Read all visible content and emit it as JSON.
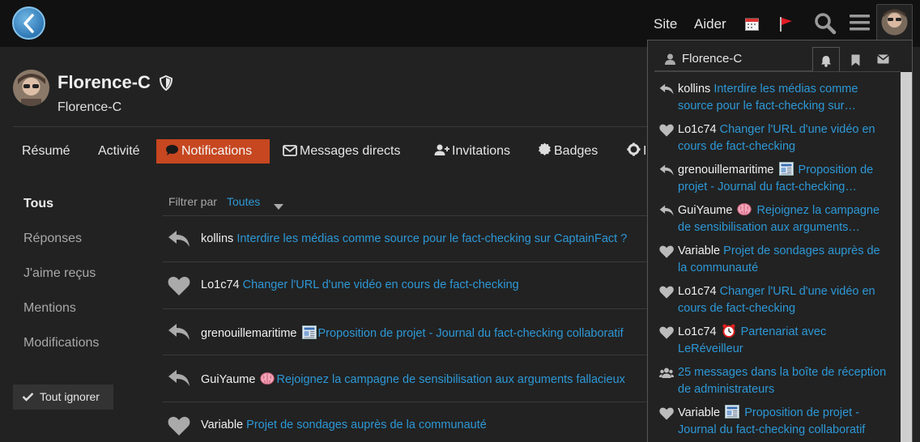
{
  "header": {
    "site_label": "Site",
    "help_label": "Aider"
  },
  "profile": {
    "name": "Florence-C",
    "username": "Florence-C"
  },
  "nav": {
    "summary": "Résumé",
    "activity": "Activité",
    "notifications": "Notifications",
    "messages": "Messages directs",
    "invitations": "Invitations",
    "badges": "Badges",
    "prefs": "I"
  },
  "side": {
    "all": "Tous",
    "replies": "Réponses",
    "likes": "J'aime reçus",
    "mentions": "Mentions",
    "edits": "Modifications",
    "ignore_all": "Tout ignorer"
  },
  "filter": {
    "label": "Filtrer par",
    "value": "Toutes"
  },
  "notifications": [
    {
      "icon": "reply-icon",
      "user": "kollins",
      "emoji": "",
      "topic": "Interdire les médias comme source pour le fact-checking sur CaptainFact ?"
    },
    {
      "icon": "heart-icon",
      "user": "Lo1c74",
      "emoji": "",
      "topic": "Changer l'URL d'une vidéo en cours de fact-checking"
    },
    {
      "icon": "reply-icon",
      "user": "grenouillemaritime",
      "emoji": "newspaper",
      "topic": "Proposition de projet - Journal du fact-checking collaboratif"
    },
    {
      "icon": "reply-icon",
      "user": "GuiYaume",
      "emoji": "brain",
      "topic": "Rejoignez la campagne de sensibilisation aux arguments fallacieux"
    },
    {
      "icon": "heart-icon",
      "user": "Variable",
      "emoji": "",
      "topic": "Projet de sondages auprès de la communauté"
    }
  ],
  "panel": {
    "username": "Florence-C",
    "items": [
      {
        "icon": "reply-icon",
        "user": "kollins",
        "emoji": "",
        "line1": "Interdire les médias comme",
        "line2": "source pour le fact-checking sur…"
      },
      {
        "icon": "heart-icon",
        "user": "Lo1c74",
        "emoji": "",
        "line1": "Changer l'URL d'une vidéo en",
        "line2": "cours de fact-checking"
      },
      {
        "icon": "reply-icon",
        "user": "grenouillemaritime",
        "emoji": "newspaper",
        "line1": "Proposition de",
        "line2": "projet - Journal du fact-checking…"
      },
      {
        "icon": "reply-icon",
        "user": "GuiYaume",
        "emoji": "brain",
        "line1": "Rejoignez la campagne",
        "line2": "de sensibilisation aux arguments…"
      },
      {
        "icon": "heart-icon",
        "user": "Variable",
        "emoji": "",
        "line1": "Projet de sondages auprès de",
        "line2": "la communauté"
      },
      {
        "icon": "heart-icon",
        "user": "Lo1c74",
        "emoji": "",
        "line1": "Changer l'URL d'une vidéo en",
        "line2": "cours de fact-checking"
      },
      {
        "icon": "heart-icon",
        "user": "Lo1c74",
        "emoji": "alarm-clock",
        "line1": "Partenariat avec",
        "line2": "LeRéveilleur"
      },
      {
        "icon": "group-icon",
        "user": "",
        "emoji": "",
        "line1": "25 messages dans la boîte de réception",
        "line2": "de administrateurs"
      },
      {
        "icon": "heart-icon",
        "user": "Variable",
        "emoji": "newspaper",
        "line1": "Proposition de projet -",
        "line2": "Journal du fact-checking collaboratif"
      }
    ]
  },
  "colors": {
    "accent": "#c64720",
    "link": "#2d98d6",
    "background": "#222222",
    "header": "#111111"
  }
}
